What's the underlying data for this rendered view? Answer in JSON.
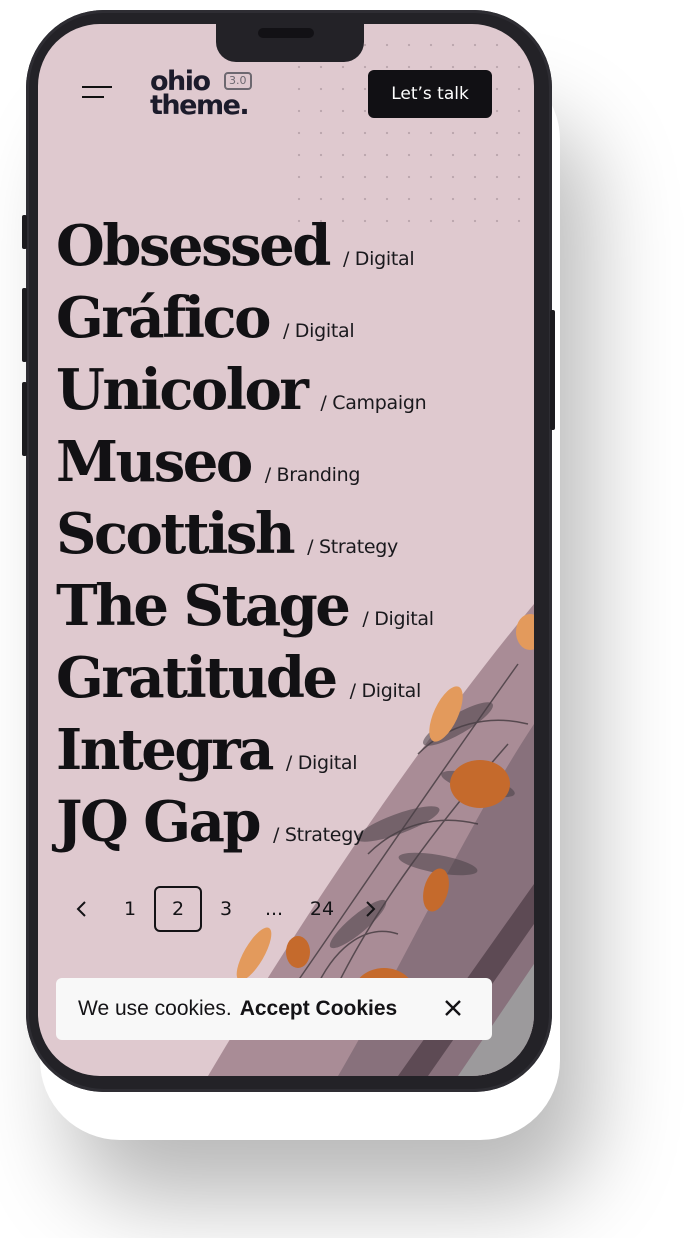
{
  "header": {
    "logo_line1": "ohio",
    "logo_line2": "theme.",
    "logo_version": "3.0",
    "cta_label": "Let’s talk",
    "menu_icon": "hamburger-menu-icon"
  },
  "projects": [
    {
      "name": "Obsessed",
      "category": "/ Digital"
    },
    {
      "name": "Gráfico",
      "category": "/ Digital"
    },
    {
      "name": "Unicolor",
      "category": "/ Campaign"
    },
    {
      "name": "Museo",
      "category": "/ Branding"
    },
    {
      "name": "Scottish",
      "category": "/ Strategy"
    },
    {
      "name": "The Stage",
      "category": "/ Digital"
    },
    {
      "name": "Gratitude",
      "category": "/ Digital"
    },
    {
      "name": "Integra",
      "category": "/ Digital"
    },
    {
      "name": "JQ Gap",
      "category": "/ Strategy"
    }
  ],
  "pagination": {
    "prev_icon": "chevron-left-icon",
    "next_icon": "chevron-right-icon",
    "pages": [
      "1",
      "2",
      "3",
      "...",
      "24"
    ],
    "current": "2"
  },
  "cookie_banner": {
    "message": "We use cookies.",
    "accept_label": "Accept Cookies",
    "close_icon": "close-icon"
  },
  "colors": {
    "background": "#dfc9cf",
    "text": "#121114",
    "accent_orange": "#c56a2c",
    "phone_frame": "#232227"
  }
}
